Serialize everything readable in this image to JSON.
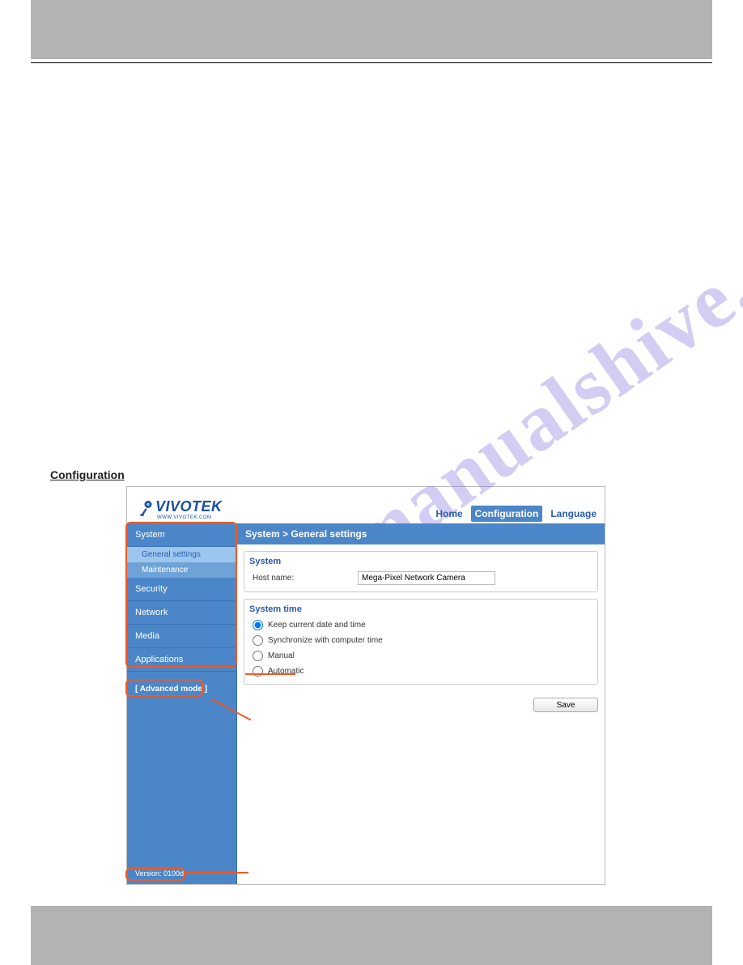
{
  "section_title": "Configuration",
  "brand": {
    "name": "VIVOTEK",
    "sub": "WWW.VIVOTEK.COM"
  },
  "nav": {
    "home": "Home",
    "configuration": "Configuration",
    "language": "Language"
  },
  "breadcrumb": "System  > General settings",
  "sidebar": {
    "items": [
      {
        "label": "System"
      },
      {
        "label": "Security"
      },
      {
        "label": "Network"
      },
      {
        "label": "Media"
      },
      {
        "label": "Applications"
      }
    ],
    "subs": [
      {
        "label": "General settings"
      },
      {
        "label": "Maintenance"
      }
    ],
    "adv": "[ Advanced mode ]",
    "version": "Version: 0100d"
  },
  "panel_system": {
    "title": "System",
    "host_label": "Host name:",
    "host_value": "Mega-Pixel Network Camera"
  },
  "panel_time": {
    "title": "System time",
    "opts": [
      "Keep current date and time",
      "Synchronize with computer time",
      "Manual",
      "Automatic"
    ]
  },
  "save": "Save",
  "watermark": "manualshive.com"
}
